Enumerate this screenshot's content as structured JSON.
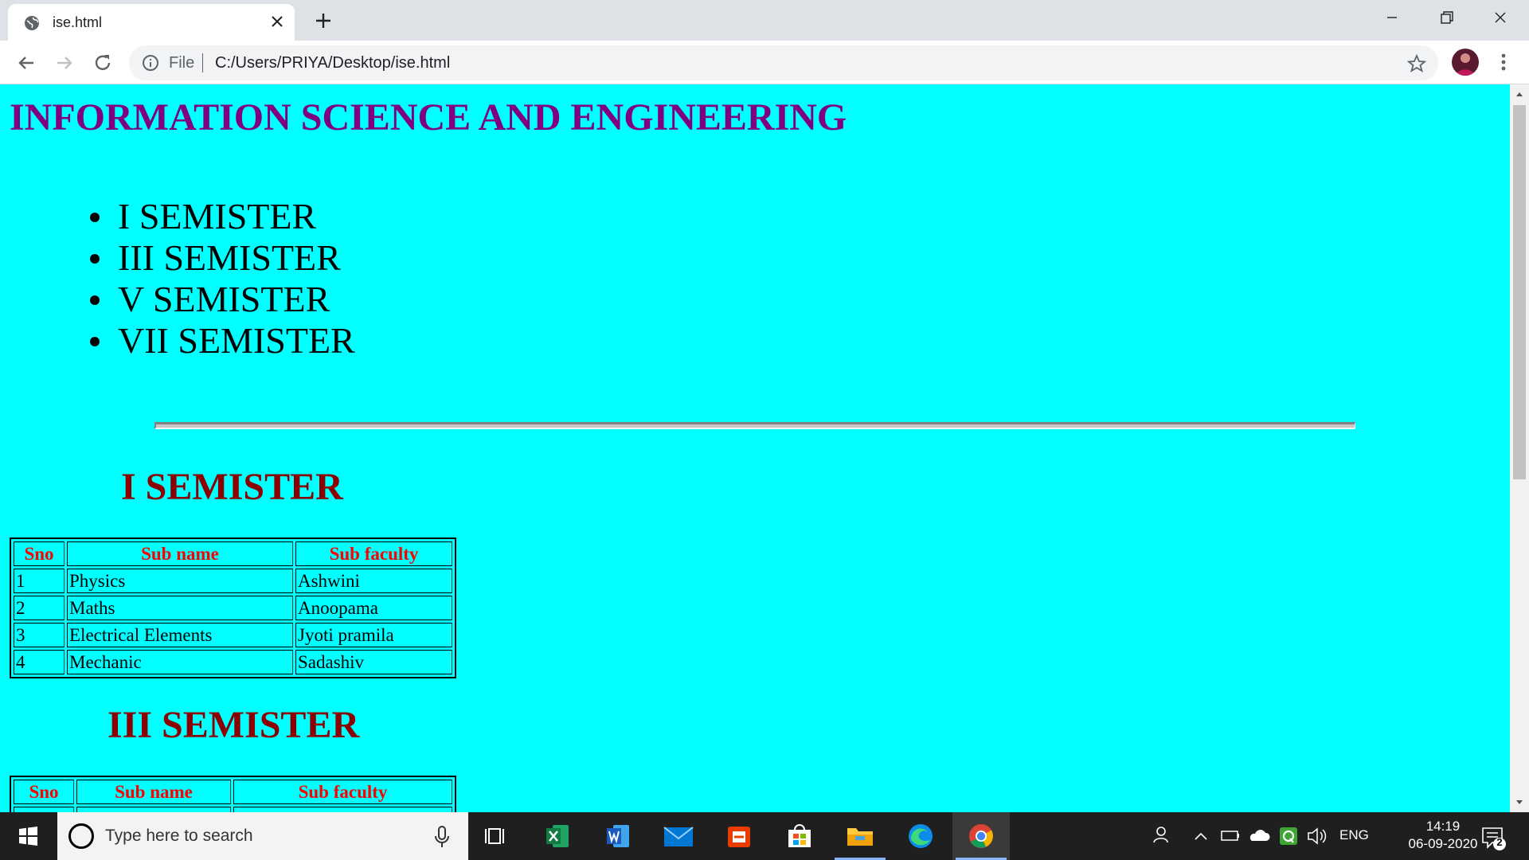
{
  "browser": {
    "tab_title": "ise.html",
    "url_scheme": "File",
    "url": "C:/Users/PRIYA/Desktop/ise.html"
  },
  "page": {
    "title": "INFORMATION SCIENCE AND ENGINEERING",
    "semesters": [
      "I SEMISTER",
      "III SEMISTER",
      "V SEMISTER",
      "VII SEMISTER"
    ],
    "sections": [
      {
        "heading": "I SEMISTER",
        "headers": [
          "Sno",
          "Sub name",
          "Sub faculty"
        ],
        "rows": [
          [
            "1",
            "Physics",
            "Ashwini"
          ],
          [
            "2",
            "Maths",
            "Anoopama"
          ],
          [
            "3",
            "Electrical Elements",
            "Jyoti pramila"
          ],
          [
            "4",
            "Mechanic",
            "Sadashiv"
          ]
        ]
      },
      {
        "heading": "III SEMISTER",
        "headers": [
          "Sno",
          "Sub name",
          "Sub faculty"
        ],
        "rows": []
      }
    ]
  },
  "taskbar": {
    "search_placeholder": "Type here to search",
    "language": "ENG",
    "time": "14:19",
    "date": "06-09-2020",
    "notification_count": "2",
    "apps": [
      "task-view",
      "excel",
      "word",
      "mail",
      "office",
      "store",
      "file-explorer",
      "edge",
      "chrome"
    ]
  },
  "colors": {
    "page_background": "#00ffff",
    "title": "#800080",
    "section_heading": "#8b0000",
    "table_header_text": "#ff0000"
  }
}
